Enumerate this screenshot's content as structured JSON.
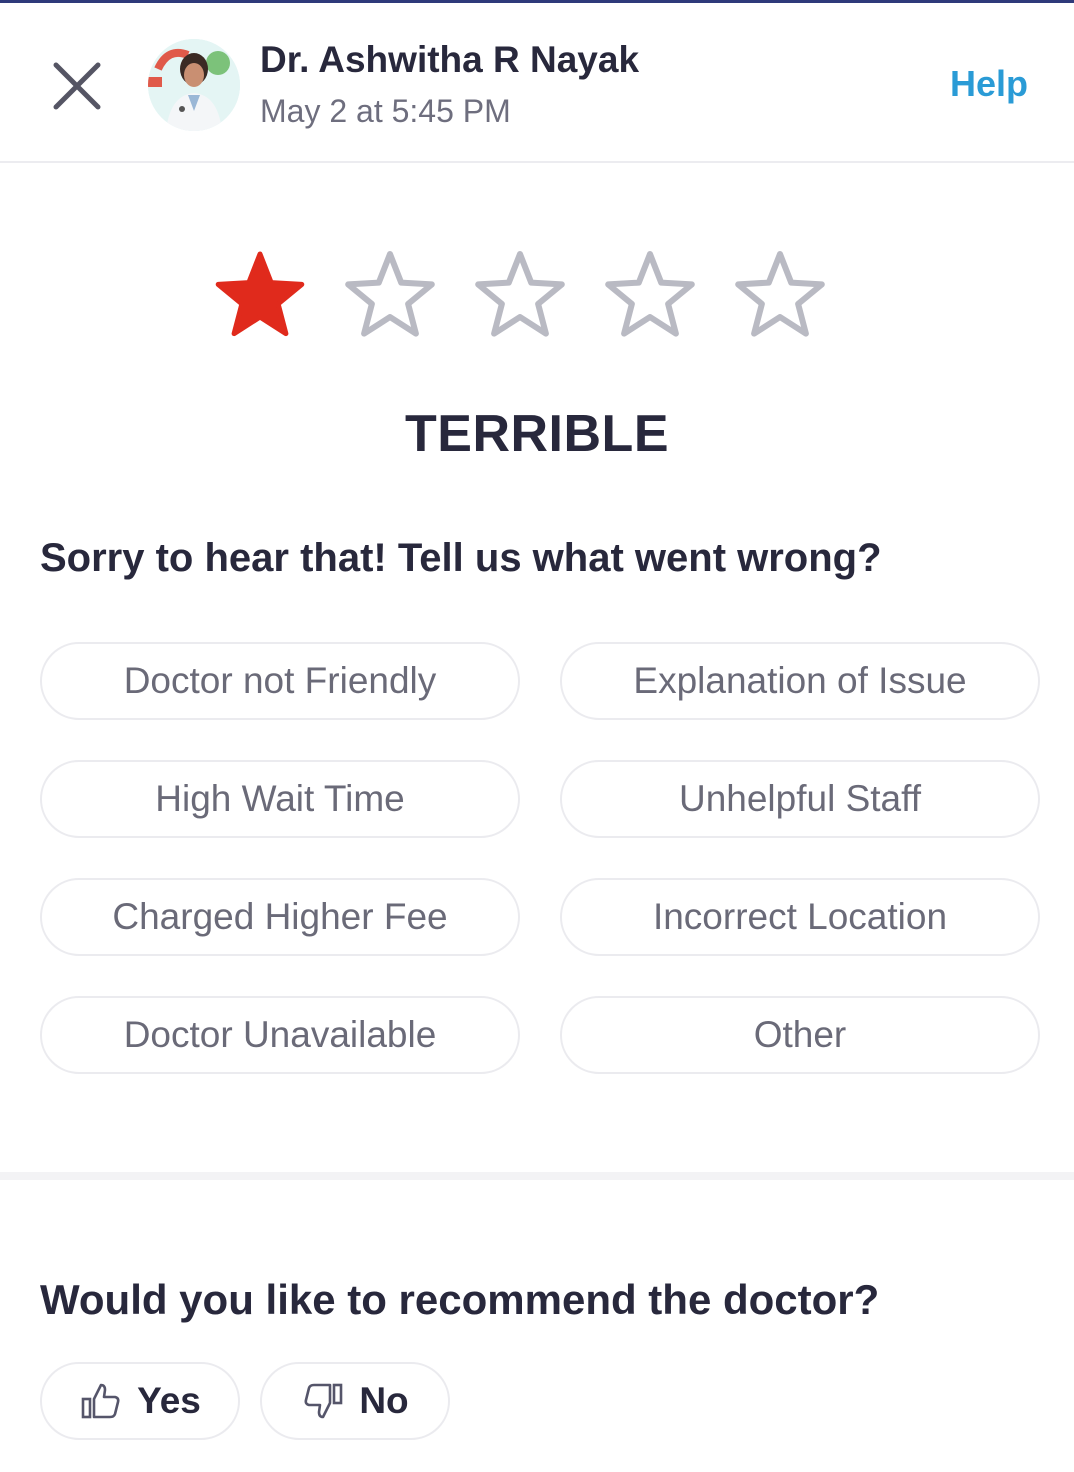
{
  "header": {
    "doctor_name": "Dr. Ashwitha R Nayak",
    "timestamp": "May 2 at 5:45 PM",
    "help_label": "Help"
  },
  "rating": {
    "value": 1,
    "max": 5,
    "label": "TERRIBLE",
    "filled_color": "#e02a1c",
    "empty_color": "#b9bac3"
  },
  "feedback": {
    "question": "Sorry to hear that! Tell us what went wrong?",
    "options": [
      "Doctor not Friendly",
      "Explanation of Issue",
      "High Wait Time",
      "Unhelpful Staff",
      "Charged Higher Fee",
      "Incorrect Location",
      "Doctor Unavailable",
      "Other"
    ]
  },
  "recommend": {
    "question": "Would you like to recommend the doctor?",
    "yes_label": "Yes",
    "no_label": "No"
  },
  "colors": {
    "accent": "#2a9bd6",
    "text": "#28283c"
  },
  "icons": [
    "close-icon",
    "star-icon",
    "thumbs-up-icon",
    "thumbs-down-icon"
  ]
}
